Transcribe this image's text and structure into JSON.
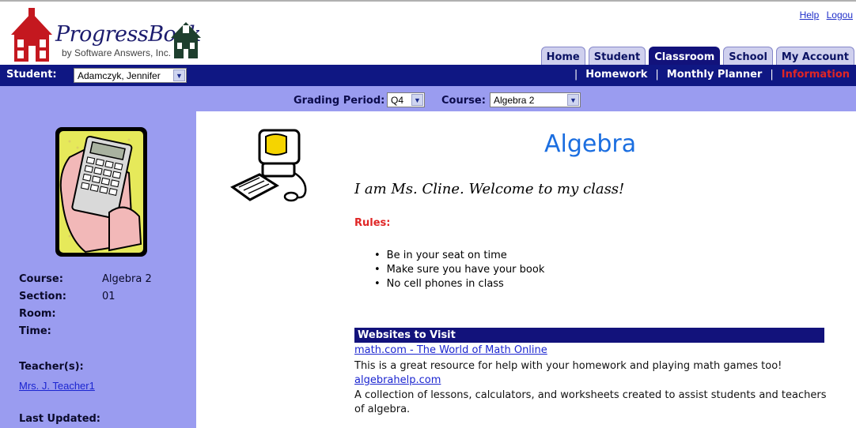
{
  "header": {
    "logo_title": "ProgressBook",
    "logo_subtitle": "by Software Answers, Inc.",
    "help_link": "Help",
    "logout_link": "Logou",
    "tabs": [
      {
        "label": "Home",
        "active": false
      },
      {
        "label": "Student",
        "active": false
      },
      {
        "label": "Classroom",
        "active": true
      },
      {
        "label": "School",
        "active": false
      },
      {
        "label": "My Account",
        "active": false
      }
    ]
  },
  "student_bar": {
    "label": "Student:",
    "student_value": "Adamczyk, Jennifer",
    "sub_nav": {
      "sep": "|",
      "homework": "Homework",
      "monthly_planner": "Monthly Planner",
      "information": "Information"
    }
  },
  "grading_bar": {
    "period_label": "Grading Period:",
    "period_value": "Q4",
    "course_label": "Course:",
    "course_value": "Algebra 2"
  },
  "sidebar": {
    "course_key": "Course:",
    "course_val": "Algebra 2",
    "section_key": "Section:",
    "section_val": "01",
    "room_key": "Room:",
    "time_key": "Time:",
    "teachers_key": "Teacher(s):",
    "teacher_link": "Mrs. J. Teacher1",
    "last_updated_key": "Last Updated:"
  },
  "main": {
    "title": "Algebra",
    "welcome": "I am Ms. Cline. Welcome to my class!",
    "rules_label": "Rules:",
    "rules": [
      "Be in your seat on time",
      "Make sure you have your book",
      "No cell phones in class"
    ],
    "websites_header": "Websites to Visit",
    "sites": [
      {
        "link": "math.com - The World of Math Online",
        "desc": "This is a great resource for help with your homework and playing math games too!"
      },
      {
        "link": "algebrahelp.com",
        "desc": "A collection of lessons, calculators, and worksheets created to assist students and teachers of algebra."
      }
    ]
  },
  "colors": {
    "nav_dark": "#0f1783",
    "sidebar_lavender": "#9a9cf0",
    "accent_red": "#e02626",
    "title_blue": "#1b6ee0"
  }
}
